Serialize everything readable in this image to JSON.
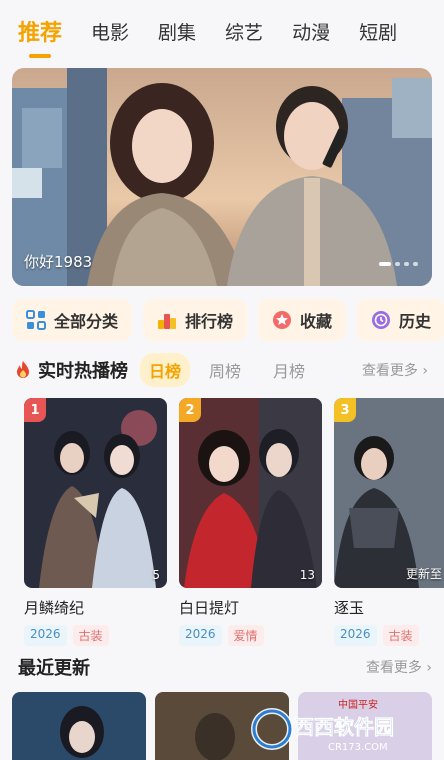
{
  "tabs": [
    "推荐",
    "电影",
    "剧集",
    "综艺",
    "动漫",
    "短剧"
  ],
  "banner": {
    "caption": "你好1983"
  },
  "quick_actions": [
    {
      "label": "全部分类",
      "icon": "category-grid-icon"
    },
    {
      "label": "排行榜",
      "icon": "ranking-bars-icon"
    },
    {
      "label": "收藏",
      "icon": "favorite-star-icon"
    },
    {
      "label": "历史",
      "icon": "history-clock-icon"
    }
  ],
  "hot": {
    "title": "实时热播榜",
    "tabs": [
      "日榜",
      "周榜",
      "月榜"
    ],
    "more": "查看更多 ›",
    "items": [
      {
        "rank": "1",
        "title": "月鳞绮纪",
        "episodes": "5",
        "year": "2026",
        "genre": "古装",
        "badge_color": "#e85555"
      },
      {
        "rank": "2",
        "title": "白日提灯",
        "episodes": "13",
        "year": "2026",
        "genre": "爱情",
        "badge_color": "#f3a826"
      },
      {
        "rank": "3",
        "title": "逐玉",
        "episodes": "更新至",
        "year": "2026",
        "genre": "古装",
        "badge_color": "#f3c126"
      }
    ]
  },
  "recent": {
    "title": "最近更新",
    "more": "查看更多 ›",
    "thumb3_text": "中国平安"
  },
  "watermark": {
    "text": "西西软件园",
    "sub": "CR173.COM"
  },
  "colors": {
    "accent": "#f5a300"
  }
}
